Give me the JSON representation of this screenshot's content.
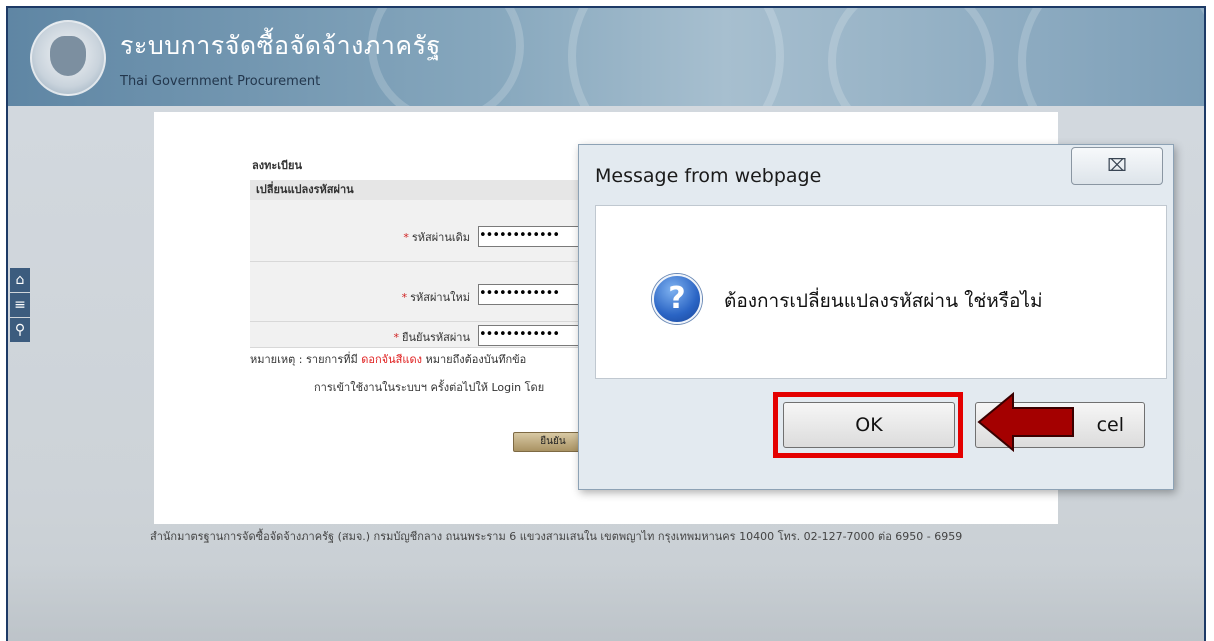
{
  "header": {
    "title_th": "ระบบการจัดซื้อจัดจ้างภาครัฐ",
    "title_en": "Thai Government Procurement"
  },
  "sidebar": {
    "icons": [
      "home-icon",
      "menu-icon",
      "search-icon"
    ]
  },
  "form": {
    "register_label": "ลงทะเบียน",
    "section_title": "เปลี่ยนแปลงรหัสผ่าน",
    "required_mark": "*",
    "fields": [
      {
        "label": "รหัสผ่านเดิม",
        "value": "••••••••••••"
      },
      {
        "label": "รหัสผ่านใหม่",
        "value": "••••••••••••"
      },
      {
        "label": "ยืนยันรหัสผ่าน",
        "value": "••••••••••••"
      }
    ],
    "note_prefix": "หมายเหตุ : รายการที่มี ",
    "note_red": "ดอกจันสีแดง",
    "note_suffix": " หมายถึงต้องบันทึกข้อ",
    "note_line2": "การเข้าใช้งานในระบบฯ ครั้งต่อไปให้ Login โดย",
    "confirm_label": "ยืนยัน"
  },
  "footer": {
    "text": "สำนักมาตรฐานการจัดซื้อจัดจ้างภาครัฐ (สมจ.) กรมบัญชีกลาง ถนนพระราม 6 แขวงสามเสนใน เขตพญาไท กรุงเทพมหานคร 10400 โทร. 02-127-7000 ต่อ 6950 - 6959"
  },
  "dialog": {
    "title": "Message from webpage",
    "close_label": "⌧",
    "icon": "question-icon",
    "message": "ต้องการเปลี่ยนแปลงรหัสผ่าน ใช่หรือไม่",
    "ok_label": "OK",
    "cancel_label_visible": "cel"
  },
  "annotation": {
    "highlight_color": "#e40000",
    "arrow_color": "#a40000"
  }
}
